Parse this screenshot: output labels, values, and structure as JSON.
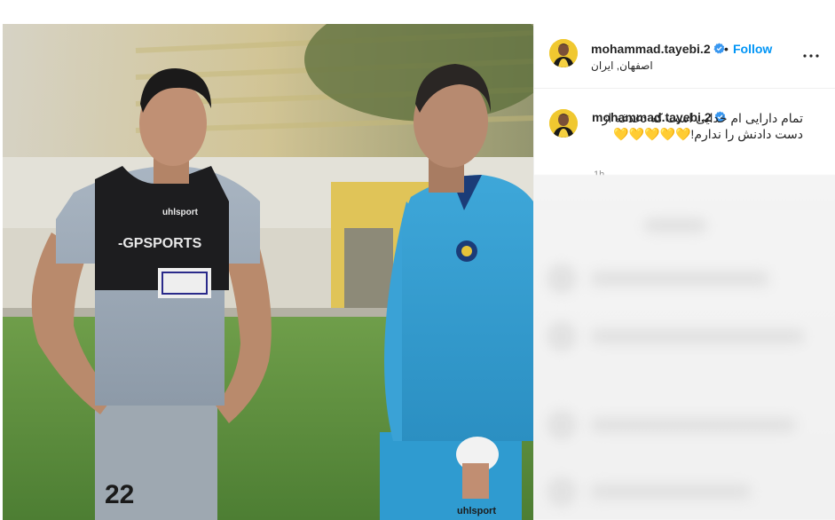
{
  "post": {
    "username": "mohammad.tayebi.2",
    "verified": true,
    "separator": "•",
    "follow_label": "Follow",
    "location": "اصفهان, ایران",
    "more_icon": "more-horizontal-icon"
  },
  "caption": {
    "username": "mohammad.tayebi.2",
    "text": "تمام دارایی ام خدایی است که دغدغه از دست دادنش را ندارم!💛💛💛💛💛",
    "time": "1h"
  },
  "photo": {
    "jersey_left_number": "22",
    "jersey_left_sponsor": "-GPSPORTS",
    "jersey_left_brand": "uhlsport",
    "jersey_right_brand": "uhlsport"
  },
  "colors": {
    "accent": "#0095f6",
    "verified": "#3897f0",
    "text": "#262626",
    "muted": "#8e8e8e"
  }
}
